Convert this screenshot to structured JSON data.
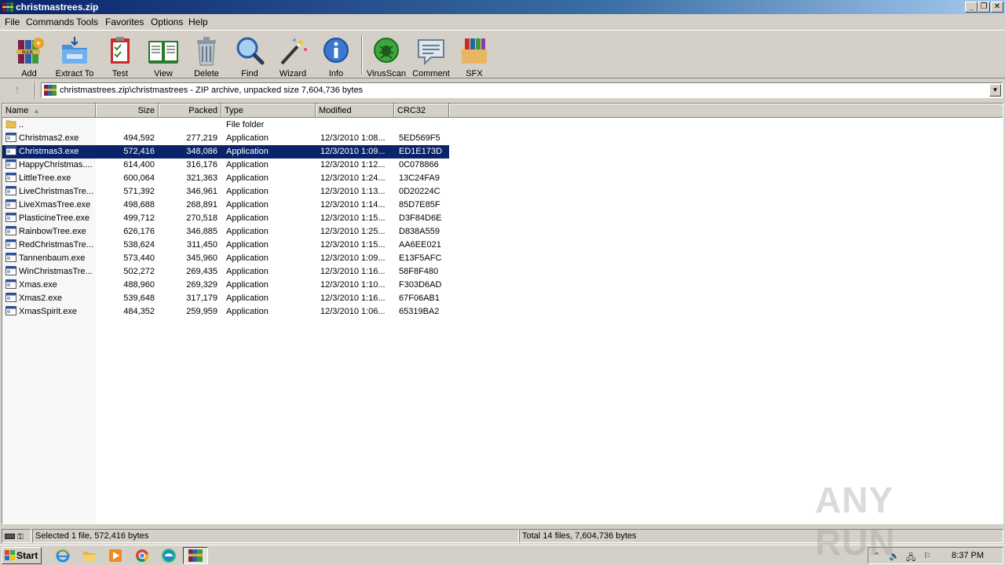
{
  "window": {
    "title": "christmastrees.zip"
  },
  "menu": [
    "File",
    "Commands",
    "Tools",
    "Favorites",
    "Options",
    "Help"
  ],
  "toolbar": [
    {
      "label": "Add",
      "icon": "add-icon"
    },
    {
      "label": "Extract To",
      "icon": "extract-to-icon"
    },
    {
      "label": "Test",
      "icon": "test-icon"
    },
    {
      "label": "View",
      "icon": "view-icon"
    },
    {
      "label": "Delete",
      "icon": "delete-icon"
    },
    {
      "label": "Find",
      "icon": "find-icon"
    },
    {
      "label": "Wizard",
      "icon": "wizard-icon"
    },
    {
      "label": "Info",
      "icon": "info-icon"
    },
    {
      "label": "VirusScan",
      "icon": "virusscan-icon"
    },
    {
      "label": "Comment",
      "icon": "comment-icon"
    },
    {
      "label": "SFX",
      "icon": "sfx-icon"
    }
  ],
  "address": {
    "path": "christmastrees.zip\\christmastrees - ZIP archive, unpacked size 7,604,736 bytes"
  },
  "columns": {
    "name": "Name",
    "size": "Size",
    "packed": "Packed",
    "type": "Type",
    "modified": "Modified",
    "crc": "CRC32"
  },
  "files": [
    {
      "name": "..",
      "size": "",
      "packed": "",
      "type": "File folder",
      "modified": "",
      "crc": "",
      "folder": true
    },
    {
      "name": "Christmas2.exe",
      "size": "494,592",
      "packed": "277,219",
      "type": "Application",
      "modified": "12/3/2010 1:08...",
      "crc": "5ED569F5"
    },
    {
      "name": "Christmas3.exe",
      "size": "572,416",
      "packed": "348,086",
      "type": "Application",
      "modified": "12/3/2010 1:09...",
      "crc": "ED1E173D",
      "selected": true
    },
    {
      "name": "HappyChristmas....",
      "size": "614,400",
      "packed": "316,176",
      "type": "Application",
      "modified": "12/3/2010 1:12...",
      "crc": "0C078866"
    },
    {
      "name": "LittleTree.exe",
      "size": "600,064",
      "packed": "321,363",
      "type": "Application",
      "modified": "12/3/2010 1:24...",
      "crc": "13C24FA9"
    },
    {
      "name": "LiveChristmasTre...",
      "size": "571,392",
      "packed": "346,961",
      "type": "Application",
      "modified": "12/3/2010 1:13...",
      "crc": "0D20224C"
    },
    {
      "name": "LiveXmasTree.exe",
      "size": "498,688",
      "packed": "268,891",
      "type": "Application",
      "modified": "12/3/2010 1:14...",
      "crc": "85D7E85F"
    },
    {
      "name": "PlasticineTree.exe",
      "size": "499,712",
      "packed": "270,518",
      "type": "Application",
      "modified": "12/3/2010 1:15...",
      "crc": "D3F84D6E"
    },
    {
      "name": "RainbowTree.exe",
      "size": "626,176",
      "packed": "346,885",
      "type": "Application",
      "modified": "12/3/2010 1:25...",
      "crc": "D838A559"
    },
    {
      "name": "RedChristmasTre...",
      "size": "538,624",
      "packed": "311,450",
      "type": "Application",
      "modified": "12/3/2010 1:15...",
      "crc": "AA6EE021"
    },
    {
      "name": "Tannenbaum.exe",
      "size": "573,440",
      "packed": "345,960",
      "type": "Application",
      "modified": "12/3/2010 1:09...",
      "crc": "E13F5AFC"
    },
    {
      "name": "WinChristmasTre...",
      "size": "502,272",
      "packed": "269,435",
      "type": "Application",
      "modified": "12/3/2010 1:16...",
      "crc": "58F8F480"
    },
    {
      "name": "Xmas.exe",
      "size": "488,960",
      "packed": "269,329",
      "type": "Application",
      "modified": "12/3/2010 1:10...",
      "crc": "F303D6AD"
    },
    {
      "name": "Xmas2.exe",
      "size": "539,648",
      "packed": "317,179",
      "type": "Application",
      "modified": "12/3/2010 1:16...",
      "crc": "67F06AB1"
    },
    {
      "name": "XmasSpirit.exe",
      "size": "484,352",
      "packed": "259,959",
      "type": "Application",
      "modified": "12/3/2010 1:06...",
      "crc": "65319BA2"
    }
  ],
  "status": {
    "left": "Selected 1 file, 572,416 bytes",
    "right": "Total 14 files, 7,604,736 bytes"
  },
  "taskbar": {
    "start": "Start",
    "apps": [
      "internet-explorer-icon",
      "file-explorer-icon",
      "media-player-icon",
      "chrome-icon",
      "edge-icon",
      "winrar-icon"
    ],
    "clock": "8:37 PM"
  },
  "watermark": {
    "text": "ANY RUN"
  },
  "colors": {
    "titlebar": "#0a246a",
    "selection": "#0a246a",
    "chrome": "#d4d0c8"
  }
}
